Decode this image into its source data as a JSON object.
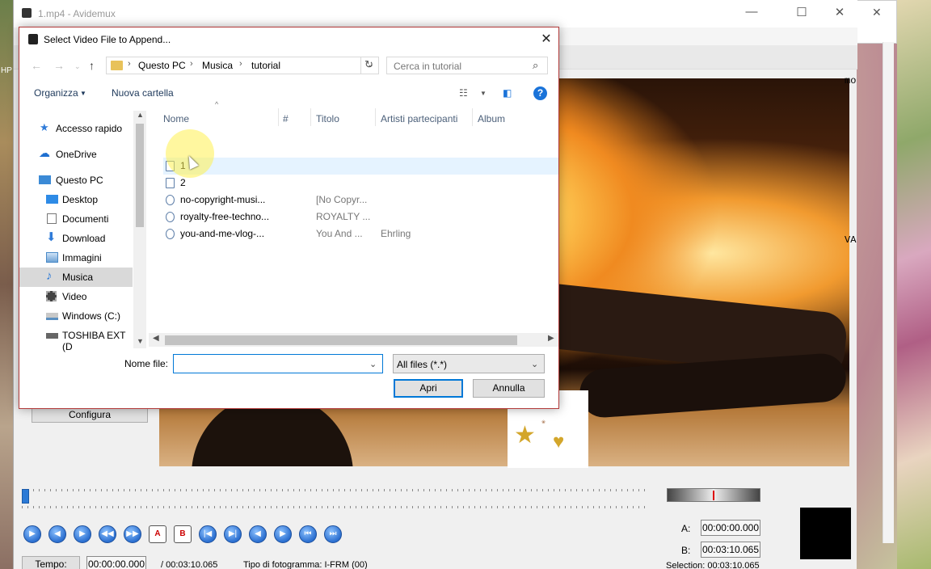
{
  "app": {
    "title": "1.mp4 - Avidemux",
    "configure_label": "Configura",
    "right_fragment_1": "mo",
    "right_fragment_2": "VA",
    "marker_a_label": "A:",
    "marker_b_label": "B:",
    "marker_a_value": "00:00:00.000",
    "marker_b_value": "00:03:10.065",
    "selection_label": "Selection: 00:03:10.065",
    "tempo_label": "Tempo:",
    "current_time": "00:00:00.000",
    "total_time": "/ 00:03:10.065",
    "frame_type": "Tipo di fotogramma:  I-FRM (00)",
    "position_fraction": 0.0
  },
  "dialog": {
    "title": "Select Video File to Append...",
    "breadcrumb": [
      "Questo PC",
      "Musica",
      "tutorial"
    ],
    "search_placeholder": "Cerca in tutorial",
    "organize_label": "Organizza",
    "new_folder_label": "Nuova cartella",
    "nav": [
      {
        "label": "Accesso rapido",
        "icon": "star-icon",
        "color": "#2f7bd8"
      },
      {
        "label": "OneDrive",
        "icon": "cloud-icon",
        "color": "#1e6fd0"
      },
      {
        "label": "Questo PC",
        "icon": "computer-icon",
        "color": "#3b8ad6"
      },
      {
        "label": "Desktop",
        "icon": "desktop-icon",
        "color": "#2e8be6"
      },
      {
        "label": "Documenti",
        "icon": "document-icon",
        "color": "#777"
      },
      {
        "label": "Download",
        "icon": "download-icon",
        "color": "#2f7bd8"
      },
      {
        "label": "Immagini",
        "icon": "image-icon",
        "color": "#4a8ac7"
      },
      {
        "label": "Musica",
        "icon": "music-icon",
        "color": "#2f7bd8"
      },
      {
        "label": "Video",
        "icon": "video-icon",
        "color": "#444"
      },
      {
        "label": "Windows (C:)",
        "icon": "drive-icon",
        "color": "#5a8fc0"
      },
      {
        "label": "TOSHIBA EXT (D",
        "icon": "usb-drive-icon",
        "color": "#666"
      }
    ],
    "columns": [
      "Nome",
      "#",
      "Titolo",
      "Artisti partecipanti",
      "Album"
    ],
    "files": [
      {
        "name": "1",
        "title": "",
        "artist": ""
      },
      {
        "name": "2",
        "title": "",
        "artist": ""
      },
      {
        "name": "no-copyright-musi...",
        "title": "[No Copyr...",
        "artist": ""
      },
      {
        "name": "royalty-free-techno...",
        "title": "ROYALTY ...",
        "artist": ""
      },
      {
        "name": "you-and-me-vlog-...",
        "title": "You And ...",
        "artist": "Ehrling"
      }
    ],
    "filename_label": "Nome file:",
    "filename_value": "",
    "filter_value": "All files (*.*)",
    "open_label": "Apri",
    "cancel_label": "Annulla"
  },
  "desktop": {
    "hp_label": "HP"
  }
}
